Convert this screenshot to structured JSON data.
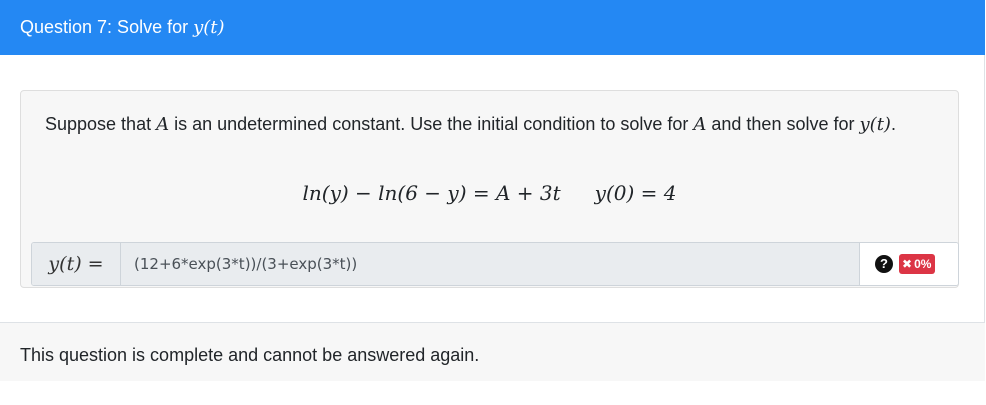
{
  "header": {
    "title_text": "Question 7: Solve for ",
    "title_math": "y(t)",
    "background_color": "#2488f3"
  },
  "problem": {
    "prompt_part1": "Suppose that ",
    "prompt_var_a1": "A",
    "prompt_part2": " is an undetermined constant. Use the initial condition to solve for ",
    "prompt_var_a2": "A",
    "prompt_part3": " and then solve for ",
    "prompt_var_y": "y(t)",
    "prompt_end": ".",
    "equation_left": "ln(y) − ln(6 − y) = A + 3t",
    "equation_right": "y(0) = 4"
  },
  "answer": {
    "label": "y(t) =",
    "value": "(12+6*exp(3*t))/(3+exp(3*t))",
    "help_icon": "question-circle-icon",
    "score_icon": "x-icon",
    "score_text": "0%",
    "score_color": "#dc3545"
  },
  "footer": {
    "status_text": "This question is complete and cannot be answered again."
  }
}
